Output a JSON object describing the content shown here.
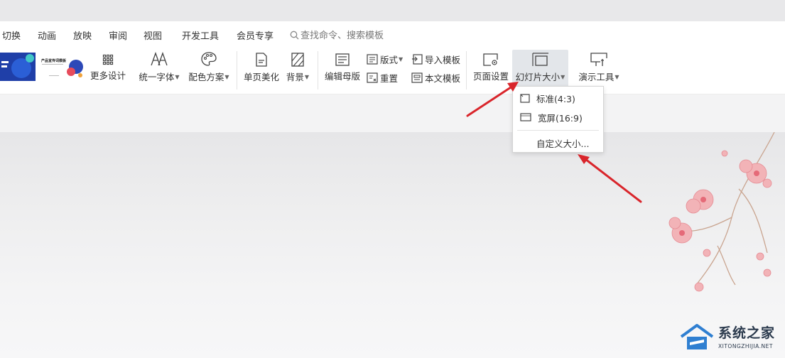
{
  "menu": {
    "tabs": [
      "切换",
      "动画",
      "放映",
      "审阅",
      "视图",
      "开发工具",
      "会员专享"
    ],
    "search_placeholder": "查找命令、搜索模板"
  },
  "ribbon": {
    "thumb2_title": "产品宣传词模板",
    "more_design": "更多设计",
    "unify_font": "统一字体",
    "color_scheme": "配色方案",
    "single_page": "单页美化",
    "background": "背景",
    "edit_master": "编辑母版",
    "layout": "版式",
    "reset": "重置",
    "import_template": "导入模板",
    "this_template": "本文模板",
    "page_setup": "页面设置",
    "slide_size": "幻灯片大小",
    "present_tools": "演示工具"
  },
  "dropdown": {
    "standard": "标准(4:3)",
    "widescreen": "宽屏(16:9)",
    "custom": "自定义大小..."
  },
  "watermark": {
    "title": "系统之家",
    "subtitle": "XITONGZHIJIA.NET"
  }
}
